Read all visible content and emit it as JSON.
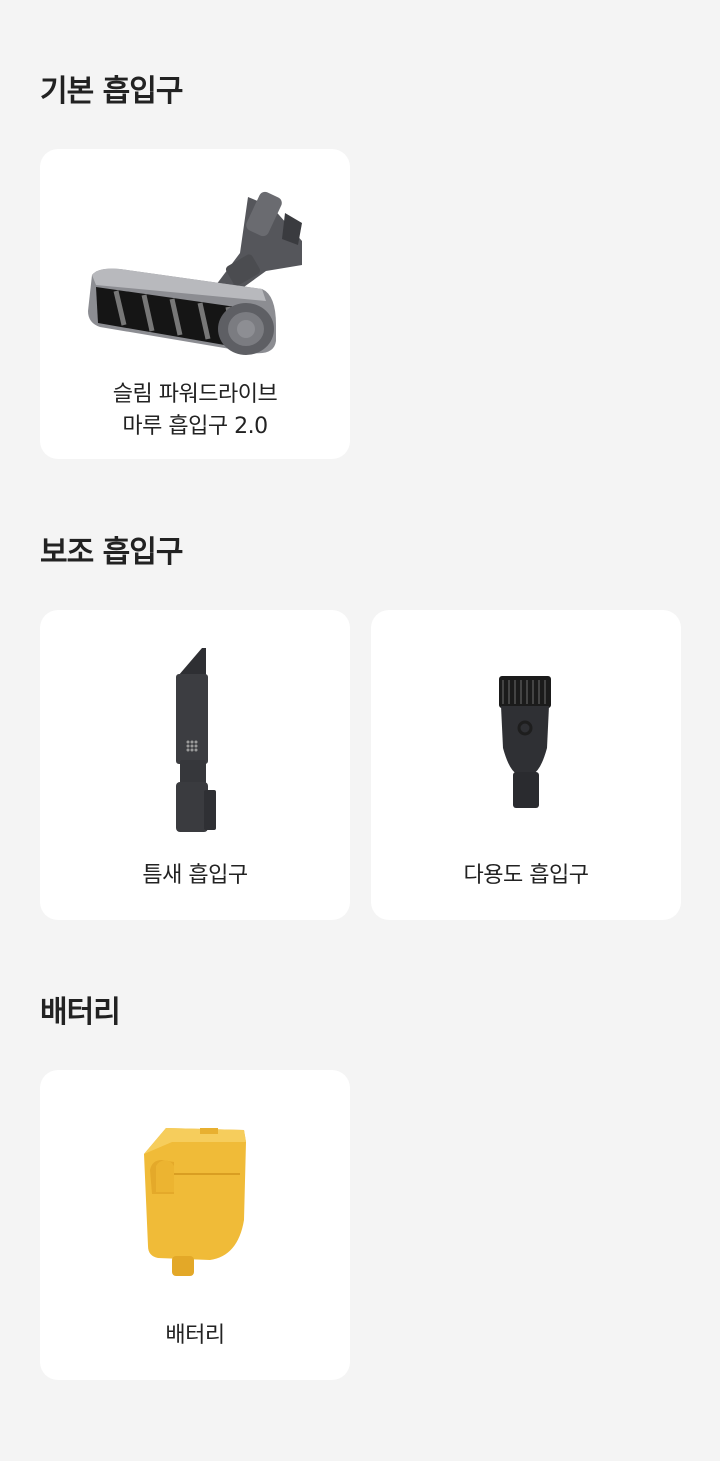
{
  "sections": [
    {
      "title": "기본 흡입구",
      "items": [
        {
          "label": "슬림 파워드라이브\n마루 흡입구 2.0",
          "icon": "power-drive-floor-nozzle"
        }
      ]
    },
    {
      "title": "보조 흡입구",
      "items": [
        {
          "label": "틈새 흡입구",
          "icon": "crevice-tool"
        },
        {
          "label": "다용도 흡입구",
          "icon": "multi-purpose-brush"
        }
      ]
    },
    {
      "title": "배터리",
      "items": [
        {
          "label": "배터리",
          "icon": "battery-pack"
        }
      ]
    }
  ],
  "colors": {
    "background": "#f4f4f4",
    "card": "#ffffff",
    "battery": "#f2bd3c",
    "tool": "#3c3c40"
  }
}
